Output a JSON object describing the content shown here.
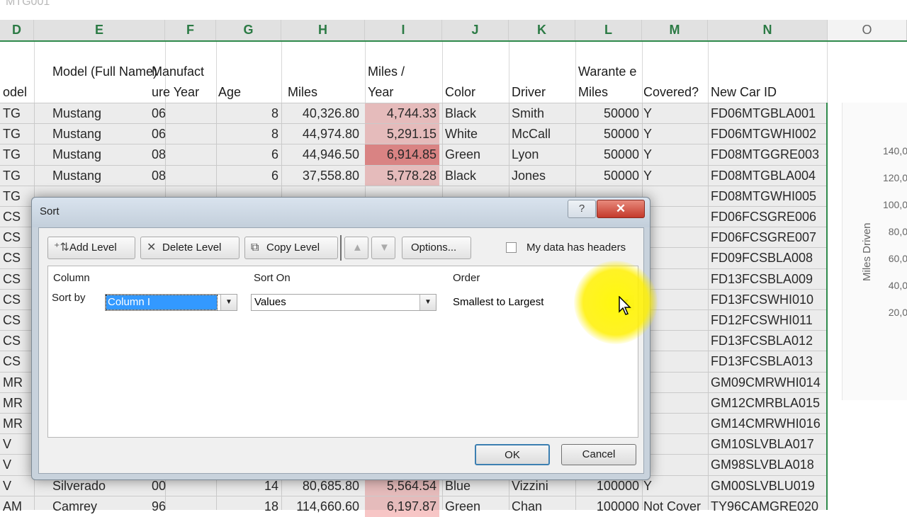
{
  "formula_bar_text": "MTG001",
  "columns": [
    "D",
    "E",
    "F",
    "G",
    "H",
    "I",
    "J",
    "K",
    "L",
    "M",
    "N",
    "O"
  ],
  "header_row": {
    "D": "odel",
    "E": "Model (Full Name)",
    "F": "Manufact ure Year",
    "G": "Age",
    "H": "Miles",
    "I": "Miles / Year",
    "J": "Color",
    "K": "Driver",
    "L": "Warante e Miles",
    "M": "Covered?",
    "N": "New Car ID"
  },
  "rows": [
    {
      "D": "TG",
      "E": "Mustang",
      "F": "06",
      "G": "8",
      "H": "40,326.80",
      "I": "4,744.33",
      "J": "Black",
      "K": "Smith",
      "L": "50000",
      "M": "Y",
      "N": "FD06MTGBLA001"
    },
    {
      "D": "TG",
      "E": "Mustang",
      "F": "06",
      "G": "8",
      "H": "44,974.80",
      "I": "5,291.15",
      "J": "White",
      "K": "McCall",
      "L": "50000",
      "M": "Y",
      "N": "FD06MTGWHI002"
    },
    {
      "D": "TG",
      "E": "Mustang",
      "F": "08",
      "G": "6",
      "H": "44,946.50",
      "I": "6,914.85",
      "J": "Green",
      "K": "Lyon",
      "L": "50000",
      "M": "Y",
      "N": "FD08MTGGRE003"
    },
    {
      "D": "TG",
      "E": "Mustang",
      "F": "08",
      "G": "6",
      "H": "37,558.80",
      "I": "5,778.28",
      "J": "Black",
      "K": "Jones",
      "L": "50000",
      "M": "Y",
      "N": "FD08MTGBLA004"
    },
    {
      "D": "TG",
      "E": "",
      "F": "",
      "G": "",
      "H": "",
      "I": "",
      "J": "",
      "K": "",
      "L": "",
      "M": "",
      "N": "FD08MTGWHI005"
    },
    {
      "D": "CS",
      "E": "",
      "F": "",
      "G": "",
      "H": "",
      "I": "",
      "J": "",
      "K": "",
      "L": "",
      "M": "",
      "N": "FD06FCSGRE006"
    },
    {
      "D": "CS",
      "E": "",
      "F": "",
      "G": "",
      "H": "",
      "I": "",
      "J": "",
      "K": "",
      "L": "",
      "M": "",
      "N": "FD06FCSGRE007"
    },
    {
      "D": "CS",
      "E": "",
      "F": "",
      "G": "",
      "H": "",
      "I": "",
      "J": "",
      "K": "",
      "L": "",
      "M": "",
      "N": "FD09FCSBLA008"
    },
    {
      "D": "CS",
      "E": "",
      "F": "",
      "G": "",
      "H": "",
      "I": "",
      "J": "",
      "K": "",
      "L": "",
      "M": "",
      "N": "FD13FCSBLA009"
    },
    {
      "D": "CS",
      "E": "",
      "F": "",
      "G": "",
      "H": "",
      "I": "",
      "J": "",
      "K": "",
      "L": "",
      "M": "",
      "N": "FD13FCSWHI010"
    },
    {
      "D": "CS",
      "E": "",
      "F": "",
      "G": "",
      "H": "",
      "I": "",
      "J": "",
      "K": "",
      "L": "",
      "M": "",
      "N": "FD12FCSWHI011"
    },
    {
      "D": "CS",
      "E": "",
      "F": "",
      "G": "",
      "H": "",
      "I": "",
      "J": "",
      "K": "",
      "L": "",
      "M": "",
      "N": "FD13FCSBLA012"
    },
    {
      "D": "CS",
      "E": "",
      "F": "",
      "G": "",
      "H": "",
      "I": "",
      "J": "",
      "K": "",
      "L": "",
      "M": "",
      "N": "FD13FCSBLA013"
    },
    {
      "D": "MR",
      "E": "",
      "F": "",
      "G": "",
      "H": "",
      "I": "",
      "J": "",
      "K": "",
      "L": "",
      "M": "",
      "N": "GM09CMRWHI014"
    },
    {
      "D": "MR",
      "E": "",
      "F": "",
      "G": "",
      "H": "",
      "I": "",
      "J": "",
      "K": "",
      "L": "",
      "M": "",
      "N": "GM12CMRBLA015"
    },
    {
      "D": "MR",
      "E": "",
      "F": "",
      "G": "",
      "H": "",
      "I": "",
      "J": "",
      "K": "",
      "L": "",
      "M": "",
      "N": "GM14CMRWHI016"
    },
    {
      "D": "V",
      "E": "",
      "F": "",
      "G": "",
      "H": "",
      "I": "",
      "J": "",
      "K": "",
      "L": "",
      "M": "",
      "N": "GM10SLVBLA017"
    },
    {
      "D": "V",
      "E": "",
      "F": "",
      "G": "",
      "H": "",
      "I": "",
      "J": "",
      "K": "",
      "L": "",
      "M": "",
      "N": "GM98SLVBLA018"
    },
    {
      "D": "V",
      "E": "Silverado",
      "F": "00",
      "G": "14",
      "H": "80,685.80",
      "I": "5,564.54",
      "J": "Blue",
      "K": "Vizzini",
      "L": "100000",
      "M": "Y",
      "N": "GM00SLVBLU019"
    },
    {
      "D": "AM",
      "E": "Camrey",
      "F": "96",
      "G": "18",
      "H": "114,660.60",
      "I": "6,197.87",
      "J": "Green",
      "K": "Chan",
      "L": "100000",
      "M": "Not Cover",
      "N": "TY96CAMGRE020"
    }
  ],
  "chart": {
    "y_ticks": [
      "140,0",
      "120,0",
      "100,0",
      "80,0",
      "60,0",
      "40,0",
      "20,0"
    ],
    "y_label": "Miles Driven"
  },
  "dialog": {
    "title": "Sort",
    "help_label": "?",
    "close_label": "✕",
    "buttons": {
      "add_level": "Add Level",
      "delete_level": "Delete Level",
      "copy_level": "Copy Level",
      "options": "Options..."
    },
    "my_data_has_headers": "My data has headers",
    "headers_checked": false,
    "list_headers": {
      "column": "Column",
      "sort_on": "Sort On",
      "order": "Order"
    },
    "level": {
      "sort_by_label": "Sort by",
      "column_value": "Column I",
      "sort_on_value": "Values",
      "order_value": "Smallest to Largest"
    },
    "ok_label": "OK",
    "cancel_label": "Cancel"
  },
  "colors": {
    "accent_green": "#2f8a4c",
    "selection_blue": "#3399ff",
    "highlight_yellow": "#fff200",
    "miles_per_year_high": "#e98585"
  }
}
